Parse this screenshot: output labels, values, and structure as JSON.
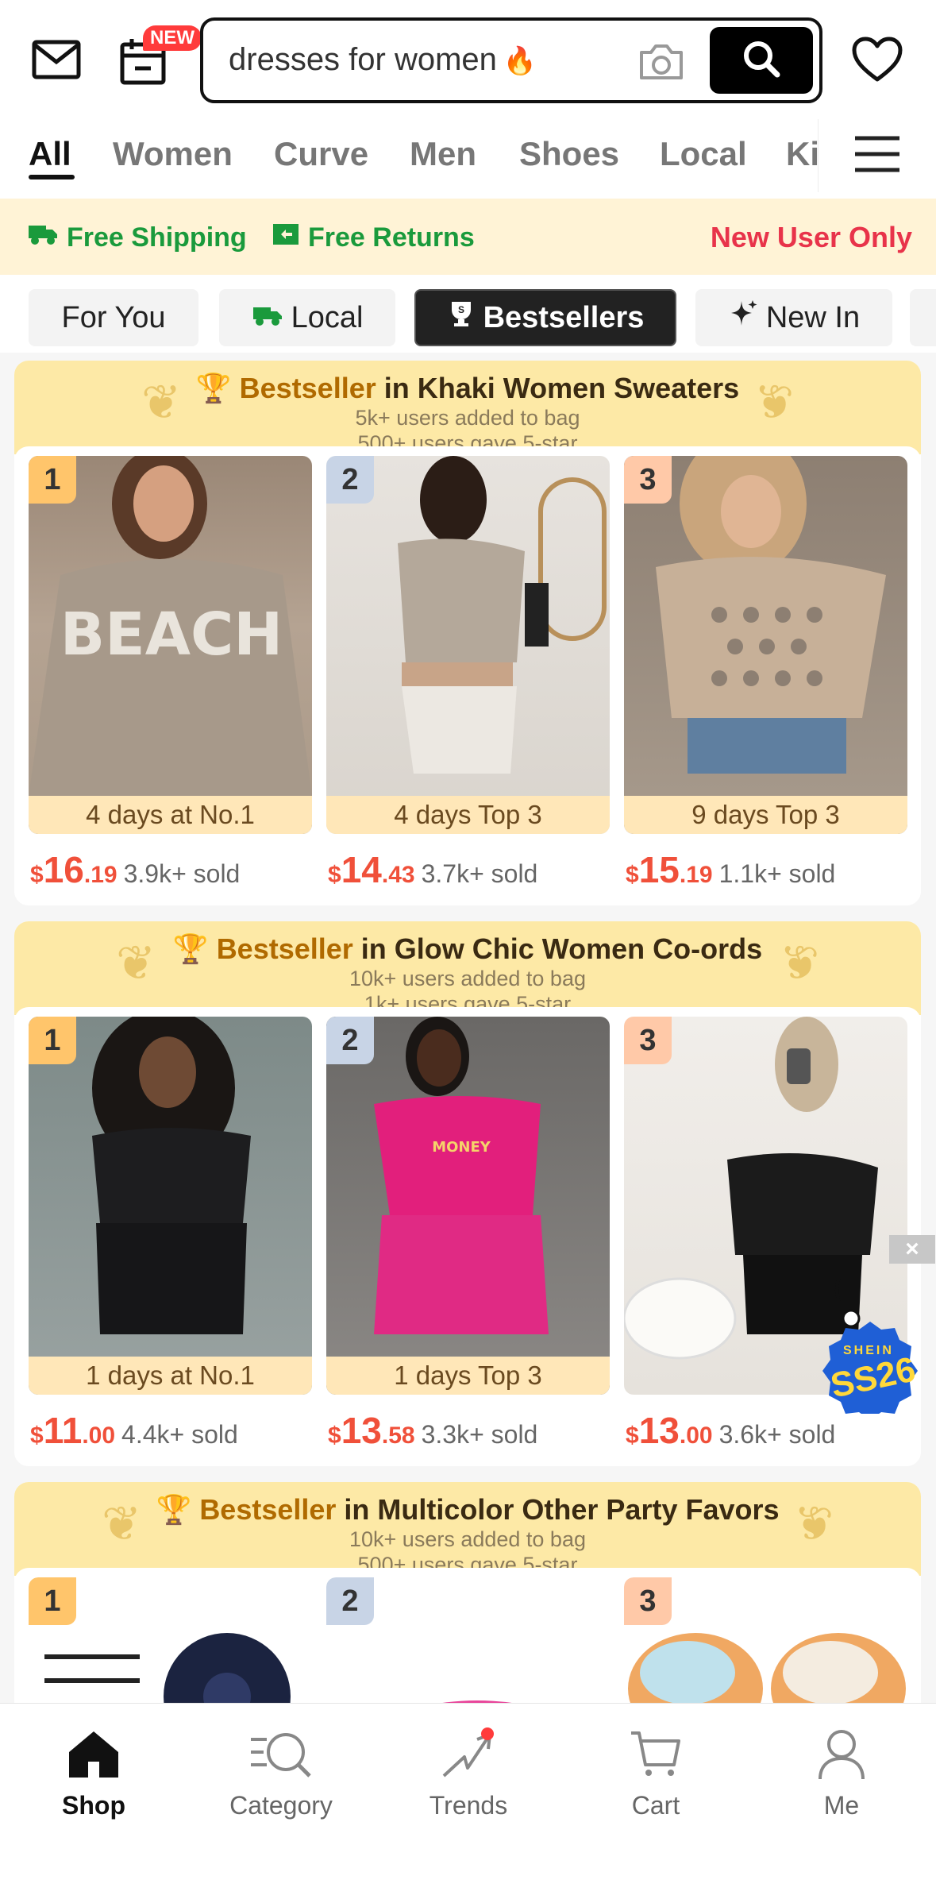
{
  "header": {
    "new_badge": "NEW",
    "search_query": "dresses for women",
    "icons": [
      "mail-icon",
      "calendar-check-icon",
      "camera-icon",
      "search-icon",
      "heart-icon"
    ]
  },
  "tabs": [
    "All",
    "Women",
    "Curve",
    "Men",
    "Shoes",
    "Local",
    "Ki"
  ],
  "active_tab": "All",
  "promo": {
    "free_shipping": "Free Shipping",
    "free_returns": "Free Returns",
    "new_user": "New User Only",
    "accent_green": "#1a9a3c",
    "accent_red": "#e8334a"
  },
  "chips": [
    "For You",
    "Local",
    "Bestsellers",
    "New In"
  ],
  "active_chip": "Bestsellers",
  "sections": [
    {
      "prefix": "Bestseller",
      "title": " in Khaki Women Sweaters",
      "sub1": "5k+ users added to bag",
      "sub2": "500+ users gave 5-star",
      "cards": [
        {
          "rank": "1",
          "ribbon": "4 days at No.1",
          "currency": "$",
          "price_int": "16",
          "price_dec": ".19",
          "sold": "3.9k+ sold"
        },
        {
          "rank": "2",
          "ribbon": "4 days Top 3",
          "currency": "$",
          "price_int": "14",
          "price_dec": ".43",
          "sold": "3.7k+ sold"
        },
        {
          "rank": "3",
          "ribbon": "9 days Top 3",
          "currency": "$",
          "price_int": "15",
          "price_dec": ".19",
          "sold": "1.1k+ sold"
        }
      ]
    },
    {
      "prefix": "Bestseller",
      "title": " in Glow Chic Women Co-ords",
      "sub1": "10k+ users added to bag",
      "sub2": "1k+ users gave 5-star",
      "cards": [
        {
          "rank": "1",
          "ribbon": "1 days at No.1",
          "currency": "$",
          "price_int": "11",
          "price_dec": ".00",
          "sold": "4.4k+ sold"
        },
        {
          "rank": "2",
          "ribbon": "1 days Top 3",
          "currency": "$",
          "price_int": "13",
          "price_dec": ".58",
          "sold": "3.3k+ sold"
        },
        {
          "rank": "3",
          "ribbon": "",
          "currency": "$",
          "price_int": "13",
          "price_dec": ".00",
          "sold": "3.6k+ sold"
        }
      ]
    },
    {
      "prefix": "Bestseller",
      "title": " in Multicolor Other Party Favors",
      "sub1": "10k+ users added to bag",
      "sub2": "500+ users gave 5-star",
      "cards": [
        {
          "rank": "1"
        },
        {
          "rank": "2"
        },
        {
          "rank": "3"
        }
      ]
    }
  ],
  "floating_badge": {
    "brand": "SHEIN",
    "code": "SS26",
    "close": "×"
  },
  "bottom_nav": [
    "Shop",
    "Category",
    "Trends",
    "Cart",
    "Me"
  ],
  "active_nav": "Shop"
}
